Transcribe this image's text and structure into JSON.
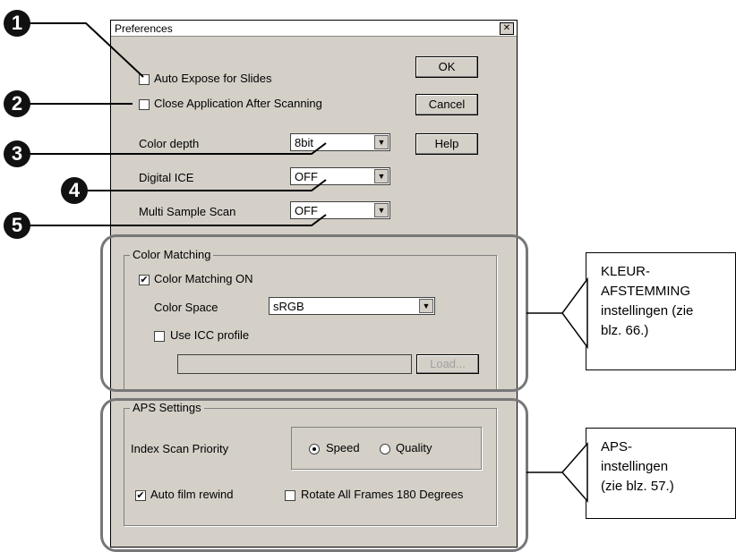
{
  "dialog": {
    "title": "Preferences",
    "close_glyph": "✕",
    "auto_expose_label": "Auto Expose for Slides",
    "close_app_label": "Close Application After Scanning",
    "color_depth_label": "Color depth",
    "color_depth_value": "8bit",
    "digital_ice_label": "Digital ICE",
    "digital_ice_value": "OFF",
    "multi_sample_label": "Multi Sample Scan",
    "multi_sample_value": "OFF",
    "ok_label": "OK",
    "cancel_label": "Cancel",
    "help_label": "Help",
    "color_matching": {
      "group_title": "Color Matching",
      "color_matching_on_label": "Color Matching ON",
      "color_space_label": "Color Space",
      "color_space_value": "sRGB",
      "use_icc_label": "Use ICC profile",
      "load_label": "Load..."
    },
    "aps": {
      "group_title": "APS Settings",
      "index_scan_label": "Index Scan Priority",
      "speed_label": "Speed",
      "quality_label": "Quality",
      "auto_rewind_label": "Auto film rewind",
      "rotate_label": "Rotate All Frames 180 Degrees"
    }
  },
  "callouts": {
    "numbers": [
      "1",
      "2",
      "3",
      "4",
      "5"
    ],
    "color_matching_note": "KLEUR-\nAFSTEMMING\ninstellingen (zie\nblz. 66.)",
    "aps_note": "APS-\ninstellingen\n(zie blz. 57.)"
  },
  "checkmark": "✔",
  "colors": {
    "dialog_bg": "#d4d0c8",
    "outline": "#777777",
    "callout_circle": "#111111"
  }
}
